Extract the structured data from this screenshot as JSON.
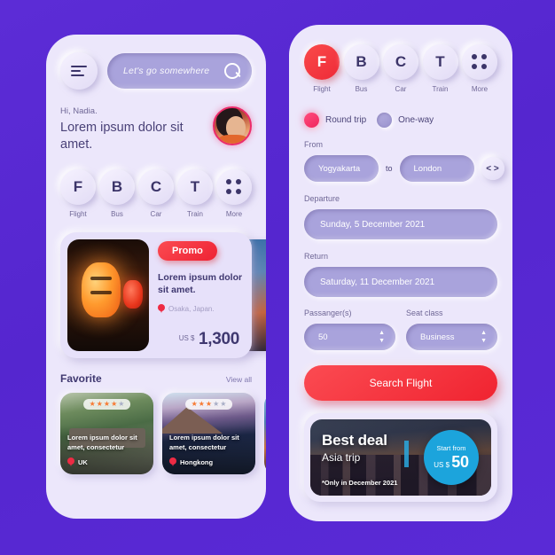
{
  "theme": {
    "background": "#5a2ad6",
    "surface": "#ece7fb",
    "accent_red": "#f0253a",
    "accent_pink": "#f0255c",
    "accent_cyan": "#1ca4dc",
    "text_dark": "#3f3870",
    "text_muted": "#6f6796",
    "field_purple": "#a9a3dc",
    "star_on": "#f77a33",
    "star_off": "#a8aec6"
  },
  "left_phone": {
    "search": {
      "placeholder": "Let's go somewhere",
      "menu_icon": "hamburger-icon",
      "search_icon": "search-icon"
    },
    "greeting": {
      "hi": "Hi, Nadia.",
      "headline": "Lorem ipsum dolor sit amet.",
      "avatar_icon": "avatar"
    },
    "categories": [
      {
        "initial": "F",
        "label": "Flight",
        "active": false
      },
      {
        "initial": "B",
        "label": "Bus",
        "active": false
      },
      {
        "initial": "C",
        "label": "Car",
        "active": false
      },
      {
        "initial": "T",
        "label": "Train",
        "active": false
      },
      {
        "initial": "",
        "label": "More",
        "active": false,
        "icon": "grid-dots-icon"
      }
    ],
    "promo": {
      "badge": "Promo",
      "title": "Lorem ipsum dolor sit amet.",
      "location": "Osaka, Japan.",
      "location_icon": "map-pin-icon",
      "currency": "US $",
      "price": "1,300"
    },
    "favorite": {
      "title": "Favorite",
      "view_all": "View all",
      "cards": [
        {
          "text": "Lorem ipsum dolor sit amet, consectetur",
          "location": "UK",
          "rating": 4,
          "max_rating": 5
        },
        {
          "text": "Lorem ipsum dolor sit amet, consectetur",
          "location": "Hongkong",
          "rating": 3,
          "max_rating": 5
        }
      ]
    }
  },
  "right_phone": {
    "categories": [
      {
        "initial": "F",
        "label": "Flight",
        "active": true
      },
      {
        "initial": "B",
        "label": "Bus",
        "active": false
      },
      {
        "initial": "C",
        "label": "Car",
        "active": false
      },
      {
        "initial": "T",
        "label": "Train",
        "active": false
      },
      {
        "initial": "",
        "label": "More",
        "active": false,
        "icon": "grid-dots-icon"
      }
    ],
    "trip_type": [
      {
        "label": "Round trip",
        "selected": true
      },
      {
        "label": "One-way",
        "selected": false
      }
    ],
    "from": {
      "label": "From",
      "origin": "Yogyakarta",
      "connector": "to",
      "destination": "London",
      "swap_icon": "swap-icon",
      "swap_glyph": "< >"
    },
    "departure": {
      "label": "Departure",
      "value": "Sunday, 5 December 2021"
    },
    "return": {
      "label": "Return",
      "value": "Saturday, 11 December 2021"
    },
    "passengers": {
      "label": "Passanger(s)",
      "value": "50",
      "stepper_icon": "chevron-updown-icon"
    },
    "seat_class": {
      "label": "Seat class",
      "value": "Business",
      "stepper_icon": "chevron-updown-icon"
    },
    "search_button": "Search Flight",
    "deal": {
      "title": "Best deal",
      "subtitle": "Asia trip",
      "note": "*Only in December 2021",
      "badge_top": "Start from",
      "badge_currency": "US $",
      "badge_price": "50"
    }
  }
}
